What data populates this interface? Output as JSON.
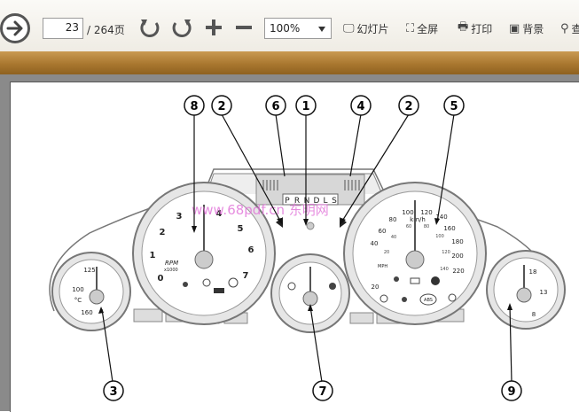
{
  "toolbar": {
    "page_current": "23",
    "page_total": "/ 264页",
    "zoom_value": "100%",
    "buttons": {
      "slideshow": "幻灯片",
      "fullscreen": "全屏",
      "print": "打印",
      "background": "背景",
      "search": "查"
    }
  },
  "document": {
    "callouts": [
      "8",
      "2",
      "6",
      "1",
      "4",
      "2",
      "5",
      "3",
      "7",
      "9"
    ],
    "tach_numbers": [
      "1",
      "2",
      "3",
      "4",
      "5",
      "6",
      "7"
    ],
    "tach_zero": "0",
    "rpm_label": "RPM",
    "rpm_unit": "x1000",
    "gear_letters": [
      "P",
      "R",
      "N",
      "D",
      "L",
      "S"
    ],
    "temp_labels": [
      "125",
      "100",
      "°C",
      "160"
    ],
    "speedo_kmh": [
      "20",
      "40",
      "60",
      "80",
      "100",
      "120",
      "140",
      "160",
      "180",
      "200",
      "220"
    ],
    "speedo_mph": [
      "20",
      "40",
      "60",
      "80",
      "100",
      "120",
      "140"
    ],
    "speedo_unit_kmh": "km/h",
    "speedo_unit_mph": "MPH",
    "fuel_labels": [
      "18",
      "13",
      "8"
    ],
    "abs_label": "ABS",
    "watermark": "www.68pdf.cn 东明网"
  }
}
